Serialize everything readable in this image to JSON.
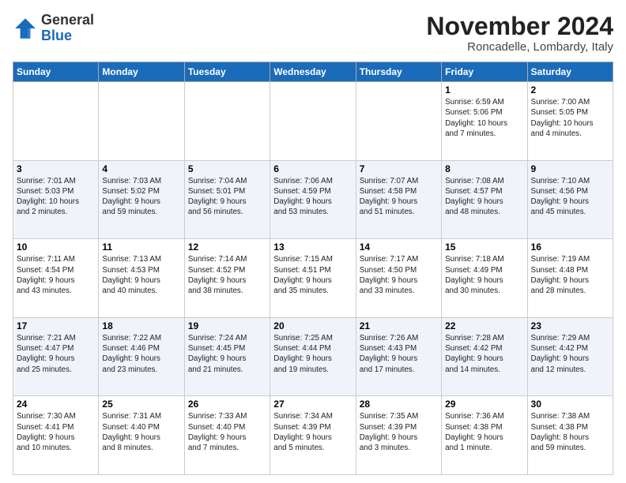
{
  "logo": {
    "general": "General",
    "blue": "Blue"
  },
  "header": {
    "month": "November 2024",
    "location": "Roncadelle, Lombardy, Italy"
  },
  "weekdays": [
    "Sunday",
    "Monday",
    "Tuesday",
    "Wednesday",
    "Thursday",
    "Friday",
    "Saturday"
  ],
  "rows": [
    [
      {
        "day": "",
        "info": ""
      },
      {
        "day": "",
        "info": ""
      },
      {
        "day": "",
        "info": ""
      },
      {
        "day": "",
        "info": ""
      },
      {
        "day": "",
        "info": ""
      },
      {
        "day": "1",
        "info": "Sunrise: 6:59 AM\nSunset: 5:06 PM\nDaylight: 10 hours\nand 7 minutes."
      },
      {
        "day": "2",
        "info": "Sunrise: 7:00 AM\nSunset: 5:05 PM\nDaylight: 10 hours\nand 4 minutes."
      }
    ],
    [
      {
        "day": "3",
        "info": "Sunrise: 7:01 AM\nSunset: 5:03 PM\nDaylight: 10 hours\nand 2 minutes."
      },
      {
        "day": "4",
        "info": "Sunrise: 7:03 AM\nSunset: 5:02 PM\nDaylight: 9 hours\nand 59 minutes."
      },
      {
        "day": "5",
        "info": "Sunrise: 7:04 AM\nSunset: 5:01 PM\nDaylight: 9 hours\nand 56 minutes."
      },
      {
        "day": "6",
        "info": "Sunrise: 7:06 AM\nSunset: 4:59 PM\nDaylight: 9 hours\nand 53 minutes."
      },
      {
        "day": "7",
        "info": "Sunrise: 7:07 AM\nSunset: 4:58 PM\nDaylight: 9 hours\nand 51 minutes."
      },
      {
        "day": "8",
        "info": "Sunrise: 7:08 AM\nSunset: 4:57 PM\nDaylight: 9 hours\nand 48 minutes."
      },
      {
        "day": "9",
        "info": "Sunrise: 7:10 AM\nSunset: 4:56 PM\nDaylight: 9 hours\nand 45 minutes."
      }
    ],
    [
      {
        "day": "10",
        "info": "Sunrise: 7:11 AM\nSunset: 4:54 PM\nDaylight: 9 hours\nand 43 minutes."
      },
      {
        "day": "11",
        "info": "Sunrise: 7:13 AM\nSunset: 4:53 PM\nDaylight: 9 hours\nand 40 minutes."
      },
      {
        "day": "12",
        "info": "Sunrise: 7:14 AM\nSunset: 4:52 PM\nDaylight: 9 hours\nand 38 minutes."
      },
      {
        "day": "13",
        "info": "Sunrise: 7:15 AM\nSunset: 4:51 PM\nDaylight: 9 hours\nand 35 minutes."
      },
      {
        "day": "14",
        "info": "Sunrise: 7:17 AM\nSunset: 4:50 PM\nDaylight: 9 hours\nand 33 minutes."
      },
      {
        "day": "15",
        "info": "Sunrise: 7:18 AM\nSunset: 4:49 PM\nDaylight: 9 hours\nand 30 minutes."
      },
      {
        "day": "16",
        "info": "Sunrise: 7:19 AM\nSunset: 4:48 PM\nDaylight: 9 hours\nand 28 minutes."
      }
    ],
    [
      {
        "day": "17",
        "info": "Sunrise: 7:21 AM\nSunset: 4:47 PM\nDaylight: 9 hours\nand 25 minutes."
      },
      {
        "day": "18",
        "info": "Sunrise: 7:22 AM\nSunset: 4:46 PM\nDaylight: 9 hours\nand 23 minutes."
      },
      {
        "day": "19",
        "info": "Sunrise: 7:24 AM\nSunset: 4:45 PM\nDaylight: 9 hours\nand 21 minutes."
      },
      {
        "day": "20",
        "info": "Sunrise: 7:25 AM\nSunset: 4:44 PM\nDaylight: 9 hours\nand 19 minutes."
      },
      {
        "day": "21",
        "info": "Sunrise: 7:26 AM\nSunset: 4:43 PM\nDaylight: 9 hours\nand 17 minutes."
      },
      {
        "day": "22",
        "info": "Sunrise: 7:28 AM\nSunset: 4:42 PM\nDaylight: 9 hours\nand 14 minutes."
      },
      {
        "day": "23",
        "info": "Sunrise: 7:29 AM\nSunset: 4:42 PM\nDaylight: 9 hours\nand 12 minutes."
      }
    ],
    [
      {
        "day": "24",
        "info": "Sunrise: 7:30 AM\nSunset: 4:41 PM\nDaylight: 9 hours\nand 10 minutes."
      },
      {
        "day": "25",
        "info": "Sunrise: 7:31 AM\nSunset: 4:40 PM\nDaylight: 9 hours\nand 8 minutes."
      },
      {
        "day": "26",
        "info": "Sunrise: 7:33 AM\nSunset: 4:40 PM\nDaylight: 9 hours\nand 7 minutes."
      },
      {
        "day": "27",
        "info": "Sunrise: 7:34 AM\nSunset: 4:39 PM\nDaylight: 9 hours\nand 5 minutes."
      },
      {
        "day": "28",
        "info": "Sunrise: 7:35 AM\nSunset: 4:39 PM\nDaylight: 9 hours\nand 3 minutes."
      },
      {
        "day": "29",
        "info": "Sunrise: 7:36 AM\nSunset: 4:38 PM\nDaylight: 9 hours\nand 1 minute."
      },
      {
        "day": "30",
        "info": "Sunrise: 7:38 AM\nSunset: 4:38 PM\nDaylight: 8 hours\nand 59 minutes."
      }
    ]
  ]
}
